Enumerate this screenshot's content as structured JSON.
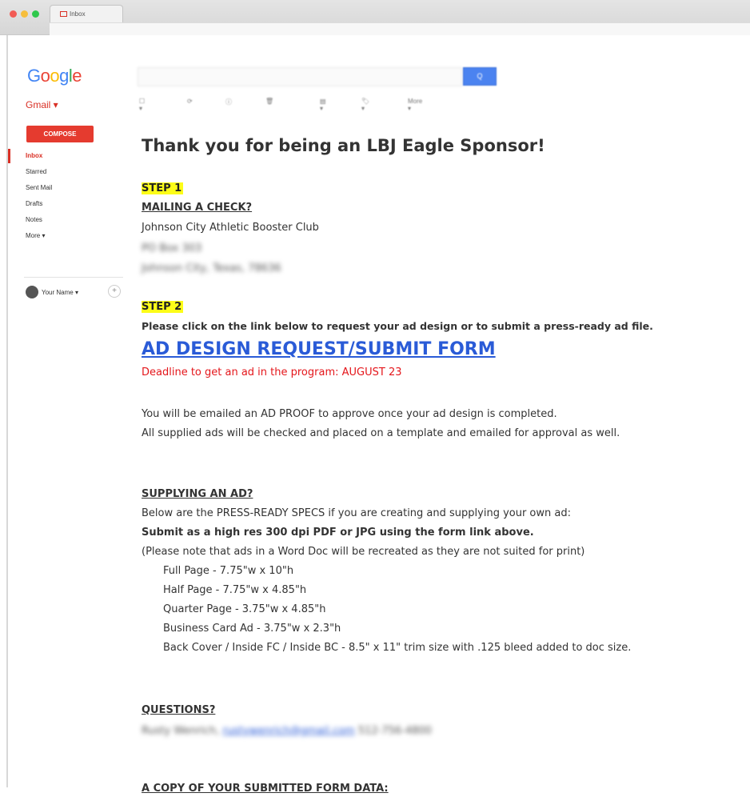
{
  "browser": {
    "tab_title": "Inbox"
  },
  "header": {
    "logo": [
      "G",
      "o",
      "o",
      "g",
      "l",
      "e"
    ],
    "search_placeholder": "",
    "search_button": "Q"
  },
  "sidebar": {
    "app_label": "Gmail ▾",
    "compose_label": "COMPOSE",
    "items": [
      {
        "label": "Inbox"
      },
      {
        "label": "Starred"
      },
      {
        "label": "Sent Mail"
      },
      {
        "label": "Drafts"
      },
      {
        "label": "Notes"
      },
      {
        "label": "More ▾"
      }
    ],
    "user_name": "Your Name ▾",
    "add_button": "+"
  },
  "toolbar": {
    "items": [
      "☐ ▾",
      "⟳",
      "ⓘ",
      "🗑",
      "▤ ▾",
      "🏷 ▾",
      "More ▾"
    ]
  },
  "email": {
    "subject": "Thank you for being an LBJ Eagle Sponsor!",
    "step1": "STEP 1",
    "mailing_heading": "MAILING A CHECK?",
    "mailing_org": "Johnson City Athletic Booster Club",
    "mailing_address_1": "PO Box 303",
    "mailing_address_2": "Johnson City, Texas, 78636",
    "step2": "STEP 2",
    "step2_instruction": "Please click on the link below to request your ad design or to submit a press-ready ad file.",
    "form_link": "AD DESIGN REQUEST/SUBMIT FORM",
    "deadline": "Deadline to get an ad in the program:  AUGUST 23",
    "proof_line_1": "You will be emailed an AD PROOF to approve once your ad design is completed.",
    "proof_line_2": "All supplied ads will be checked and placed on a template and emailed for approval as well.",
    "supply_heading": "SUPPLYING AN AD?",
    "supply_line_1": "Below are the PRESS-READY SPECS if you are creating and supplying your own ad:",
    "supply_line_2": "Submit as a high res 300 dpi PDF or JPG using the form link above.",
    "supply_line_3": "(Please note that ads in a Word Doc will be recreated as they are not suited for print)",
    "specs": [
      "Full Page - 7.75\"w x 10\"h",
      "Half Page - 7.75\"w x 4.85\"h",
      "Quarter Page - 3.75\"w x 4.85\"h",
      "Business Card Ad - 3.75\"w x 2.3\"h",
      "Back Cover / Inside FC / Inside BC - 8.5\" x 11\" trim size with .125 bleed added to doc size."
    ],
    "questions_heading": "QUESTIONS?",
    "contact_name": "Rusty Wenrich,",
    "contact_email": "rustywenrich@gmail.com",
    "contact_phone": "512-756-4800",
    "copy_heading": "A COPY OF YOUR SUBMITTED FORM DATA:"
  }
}
